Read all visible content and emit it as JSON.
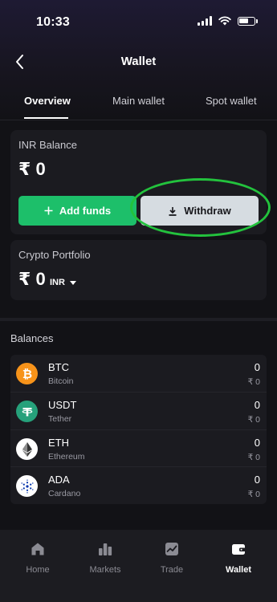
{
  "status_bar": {
    "time": "10:33"
  },
  "header": {
    "title": "Wallet"
  },
  "tabs": [
    {
      "label": "Overview",
      "active": true
    },
    {
      "label": "Main wallet",
      "active": false
    },
    {
      "label": "Spot wallet",
      "active": false
    }
  ],
  "inr_card": {
    "label": "INR Balance",
    "currency_symbol": "₹",
    "amount": "0",
    "add_funds_label": "Add funds",
    "withdraw_label": "Withdraw"
  },
  "crypto_card": {
    "label": "Crypto Portfolio",
    "currency_symbol": "₹",
    "amount": "0",
    "currency_select": "INR"
  },
  "balances": {
    "title": "Balances",
    "items": [
      {
        "symbol": "BTC",
        "name": "Bitcoin",
        "qty": "0",
        "inr": "₹ 0",
        "icon": "bitcoin-icon",
        "color": "#f7931a"
      },
      {
        "symbol": "USDT",
        "name": "Tether",
        "qty": "0",
        "inr": "₹ 0",
        "icon": "tether-icon",
        "color": "#26a17b"
      },
      {
        "symbol": "ETH",
        "name": "Ethereum",
        "qty": "0",
        "inr": "₹ 0",
        "icon": "ethereum-icon",
        "color": "#ffffff"
      },
      {
        "symbol": "ADA",
        "name": "Cardano",
        "qty": "0",
        "inr": "₹ 0",
        "icon": "cardano-icon",
        "color": "#ffffff"
      }
    ]
  },
  "bottom_nav": [
    {
      "label": "Home",
      "icon": "home-icon",
      "active": false
    },
    {
      "label": "Markets",
      "icon": "markets-icon",
      "active": false
    },
    {
      "label": "Trade",
      "icon": "trade-icon",
      "active": false
    },
    {
      "label": "Wallet",
      "icon": "wallet-icon",
      "active": true
    }
  ],
  "colors": {
    "accent_green": "#1dbf6a",
    "highlight_ring": "#23c23d",
    "background": "#121216"
  }
}
